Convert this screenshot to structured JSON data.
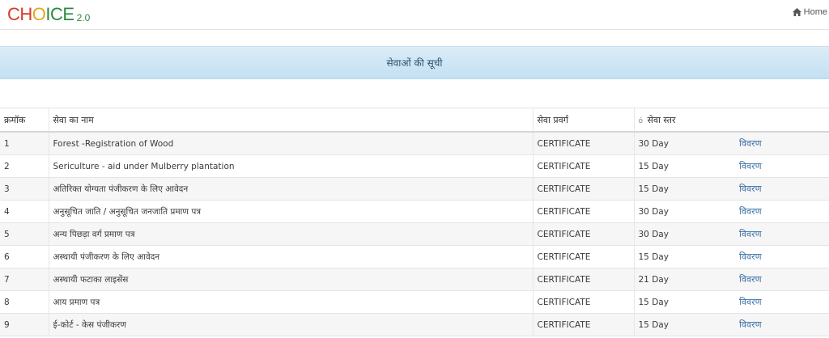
{
  "header": {
    "logo": {
      "letters": [
        {
          "ch": "C",
          "color": "#d9382c"
        },
        {
          "ch": "H",
          "color": "#d9382c"
        },
        {
          "ch": "O",
          "color": "#e6a520"
        },
        {
          "ch": "I",
          "color": "#2b8a3e"
        },
        {
          "ch": "C",
          "color": "#2b8a3e"
        },
        {
          "ch": "E",
          "color": "#2b8a3e"
        }
      ],
      "version": "2.0",
      "version_color": "#2b8a3e"
    },
    "home_label": "Home"
  },
  "banner": {
    "title": "सेवाओं की सूची"
  },
  "table": {
    "headers": {
      "serial": "क्रमॉक",
      "name": "सेवा का नाम",
      "category": "सेवा प्रवर्ग",
      "sort_glyph": "ó",
      "level": "सेवा स्तर"
    },
    "rows": [
      {
        "no": "1",
        "name": "Forest -Registration of Wood",
        "category": "CERTIFICATE",
        "days": "30 Day",
        "action": "विवरण"
      },
      {
        "no": "2",
        "name": "Sericulture - aid under Mulberry plantation",
        "category": "CERTIFICATE",
        "days": "15 Day",
        "action": "विवरण"
      },
      {
        "no": "3",
        "name": "अतिरिक्त योग्यता पंजीकरण के लिए आवेदन",
        "category": "CERTIFICATE",
        "days": "15 Day",
        "action": "विवरण"
      },
      {
        "no": "4",
        "name": "अनुसूचित जाति / अनुसूचित जनजाति प्रमाण पत्र",
        "category": "CERTIFICATE",
        "days": "30 Day",
        "action": "विवरण"
      },
      {
        "no": "5",
        "name": "अन्य पिछड़ा वर्ग प्रमाण पत्र",
        "category": "CERTIFICATE",
        "days": "30 Day",
        "action": "विवरण"
      },
      {
        "no": "6",
        "name": "अस्थायी पंजीकरण के लिए आवेदन",
        "category": "CERTIFICATE",
        "days": "15 Day",
        "action": "विवरण"
      },
      {
        "no": "7",
        "name": "अस्थायी फटाका लाइसेंस",
        "category": "CERTIFICATE",
        "days": "21 Day",
        "action": "विवरण"
      },
      {
        "no": "8",
        "name": "आय प्रमाण पत्र",
        "category": "CERTIFICATE",
        "days": "15 Day",
        "action": "विवरण"
      },
      {
        "no": "9",
        "name": "ई-कोर्ट - केस पंजीकरण",
        "category": "CERTIFICATE",
        "days": "15 Day",
        "action": "विवरण"
      }
    ]
  }
}
